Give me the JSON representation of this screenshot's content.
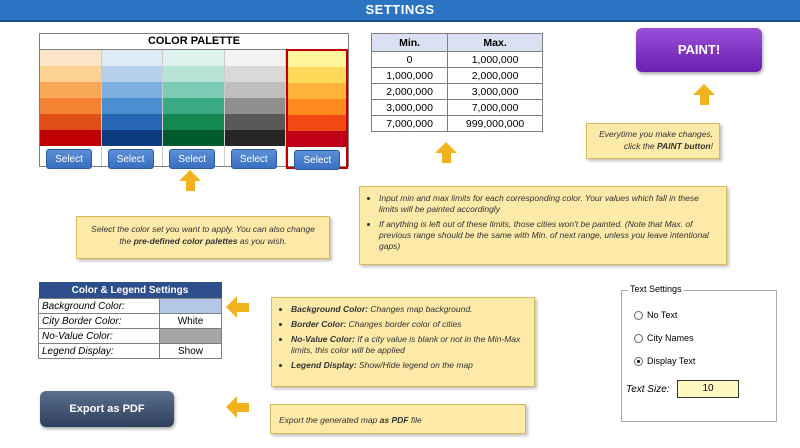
{
  "header": {
    "title": "SETTINGS"
  },
  "palette": {
    "title": "COLOR PALETTE",
    "select_label": "Select",
    "columns": [
      {
        "colors": [
          "#fce4c6",
          "#fbd28f",
          "#f9a857",
          "#f48231",
          "#e04f15",
          "#c00000"
        ]
      },
      {
        "colors": [
          "#deeaf6",
          "#b4d0ea",
          "#7eb0df",
          "#4a8fd0",
          "#2666b3",
          "#0b3a7e"
        ]
      },
      {
        "colors": [
          "#dff3ee",
          "#b7e4d7",
          "#7ccbb4",
          "#3aa985",
          "#138852",
          "#005c2c"
        ]
      },
      {
        "colors": [
          "#f2f2f2",
          "#d9d9d9",
          "#bfbfbf",
          "#8f8f8f",
          "#595959",
          "#262626"
        ]
      },
      {
        "colors": [
          "#fff59d",
          "#ffd95a",
          "#ffb43c",
          "#ff8a1e",
          "#f24a14",
          "#c00018"
        ]
      }
    ],
    "selected_index": 4
  },
  "minmax": {
    "headers": [
      "Min.",
      "Max."
    ],
    "rows": [
      [
        "0",
        "1,000,000"
      ],
      [
        "1,000,000",
        "2,000,000"
      ],
      [
        "2,000,000",
        "3,000,000"
      ],
      [
        "3,000,000",
        "7,000,000"
      ],
      [
        "7,000,000",
        "999,000,000"
      ]
    ]
  },
  "paint": {
    "label": "PAINT!"
  },
  "notes": {
    "paint_note_a": "Everytime you make changes,",
    "paint_note_b": "click the ",
    "paint_note_c": "PAINT button",
    "paint_note_d": "!",
    "limits_1": "Input min and max limits for each corresponding color. Your values which fall in these limits will be painted accordingly",
    "limits_2": "If anything is left out of these limits, those cities won't be painted. (Note that Max. of previous range should be the same with Min. of next range, unless you leave intentional gaps)",
    "palette_a": "Select the color set you want to apply. You can also change the ",
    "palette_b": "pre-defined color palettes",
    "palette_c": " as you wish.",
    "bg_label": "Background  Color:",
    "bg_text": " Changes map background.",
    "border_label": "Border Color:",
    "border_text": " Changes border color of cities",
    "novalue_label": "No-Value Color:",
    "novalue_text": " If a city value is blank or not in the Min-Max limits, this color will be applied",
    "legend_label": "Legend Display:",
    "legend_text": "  Show/Hide legend on the map",
    "export_a": "Export the generated map ",
    "export_b": "as PDF",
    "export_c": " file"
  },
  "color_legend": {
    "title": "Color & Legend Settings",
    "rows": [
      {
        "label": "Background Color:",
        "value": "",
        "color": "#b4c7e7"
      },
      {
        "label": "City Border Color:",
        "value": "White",
        "color": ""
      },
      {
        "label": "No-Value Color:",
        "value": "",
        "color": "#a6a6a6"
      },
      {
        "label": "Legend Display:",
        "value": "Show",
        "color": ""
      }
    ]
  },
  "export": {
    "label": "Export as PDF"
  },
  "text_settings": {
    "title": "Text Settings",
    "options": [
      {
        "label": "No Text",
        "selected": false
      },
      {
        "label": "City Names",
        "selected": false
      },
      {
        "label": "Display Text",
        "selected": true
      }
    ],
    "size_label": "Text Size:",
    "size_value": "10"
  }
}
